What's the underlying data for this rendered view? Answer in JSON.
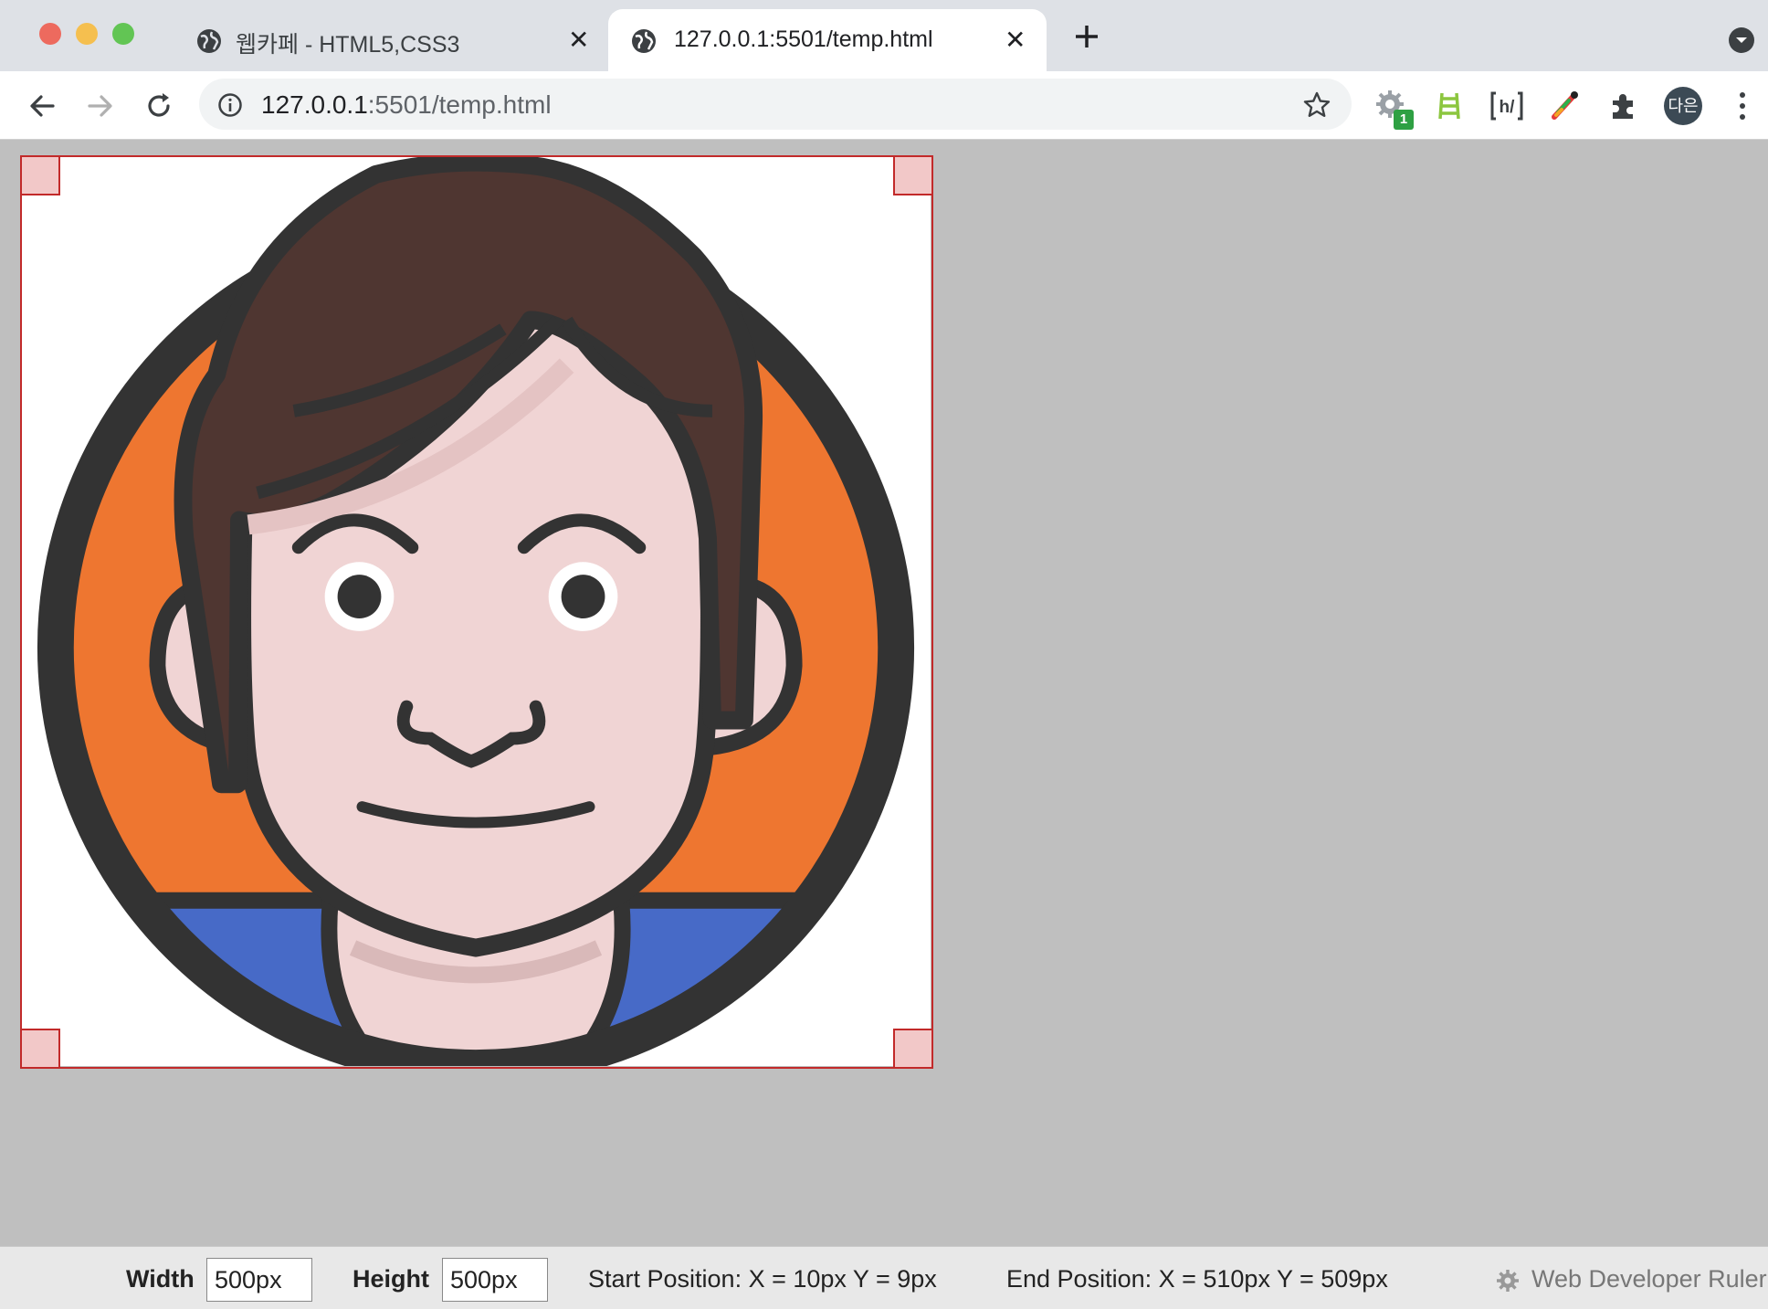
{
  "browser": {
    "tabs": [
      {
        "title": "웹카페 - HTML5,CSS3",
        "active": false
      },
      {
        "title": "127.0.0.1:5501/temp.html",
        "active": true
      }
    ],
    "address": {
      "host": "127.0.0.1",
      "rest": ":5501/temp.html"
    },
    "profile_initials": "다은",
    "extension_badge": "1",
    "icons": [
      "back-icon",
      "forward-icon",
      "reload-icon",
      "info-icon",
      "star-icon",
      "gear-extension-icon",
      "ladder-extension-icon",
      "hcode-extension-icon",
      "colorpicker-extension-icon",
      "puzzle-icon",
      "kebab-menu-icon"
    ]
  },
  "page": {
    "image": "cartoon avatar of a smiling man with brown hair on an orange circle",
    "colors": {
      "orange": "#ee7630",
      "hair": "#4f3631",
      "skin": "#f0d4d4",
      "shirt": "#476ac7",
      "outline": "#333333"
    }
  },
  "ruler": {
    "width_label": "Width",
    "width_value": "500px",
    "height_label": "Height",
    "height_value": "500px",
    "start_position": "Start Position: X = 10px   Y = 9px",
    "end_position": "End Position: X = 510px   Y = 509px",
    "brand": "Web Developer Ruler"
  }
}
